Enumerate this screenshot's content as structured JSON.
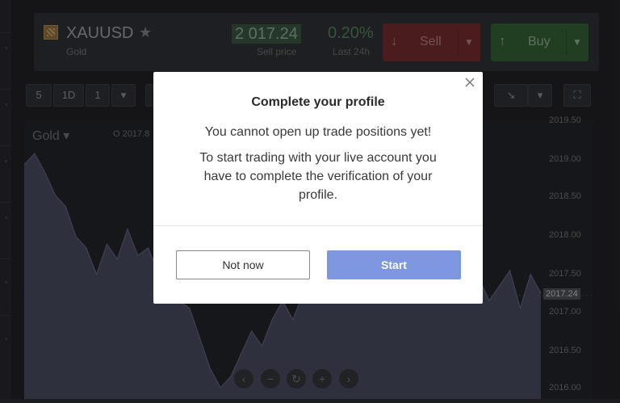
{
  "instrument": {
    "symbol": "XAUUSD",
    "name": "Gold",
    "sell_price": "2 017.24",
    "sell_price_caption": "Sell price",
    "change": "0.20%",
    "change_caption": "Last 24h",
    "sell_label": "Sell",
    "buy_label": "Buy"
  },
  "toolbar": {
    "buttons": [
      "5",
      "1D",
      "1"
    ]
  },
  "chart": {
    "series_label": "Gold ▾",
    "ohlc_text": "O  2017.8",
    "price_axis": [
      "2019.50",
      "2019.00",
      "2018.50",
      "2018.00",
      "2017.50",
      "2017.00",
      "2016.50",
      "2016.00"
    ],
    "last_price_tag": "2017.24"
  },
  "chart_data": {
    "type": "area",
    "ylim": [
      2015.9,
      2019.6
    ],
    "x": [
      0,
      2,
      4,
      6,
      8,
      10,
      12,
      14,
      16,
      18,
      20,
      22,
      24,
      26,
      28,
      30,
      32,
      34,
      36,
      38,
      40,
      42,
      44,
      46,
      48,
      50,
      52,
      54,
      56,
      58,
      60,
      62,
      64,
      66,
      68,
      70,
      72,
      74,
      76,
      78,
      80,
      82,
      84,
      86,
      88,
      90,
      92,
      94,
      96,
      98,
      100
    ],
    "y": [
      2019.0,
      2019.15,
      2018.9,
      2018.6,
      2018.45,
      2018.05,
      2017.9,
      2017.55,
      2017.95,
      2017.75,
      2018.15,
      2017.8,
      2017.9,
      2017.55,
      2017.3,
      2017.2,
      2017.1,
      2016.7,
      2016.3,
      2016.05,
      2016.2,
      2016.5,
      2016.8,
      2016.6,
      2016.95,
      2017.2,
      2016.95,
      2017.3,
      2017.2,
      2017.5,
      2017.6,
      2017.35,
      2017.4,
      2017.2,
      2017.5,
      2017.7,
      2017.45,
      2017.35,
      2017.6,
      2017.5,
      2017.4,
      2017.55,
      2017.3,
      2017.45,
      2017.5,
      2017.2,
      2017.4,
      2017.6,
      2017.1,
      2017.55,
      2017.3
    ]
  },
  "nav_icons": [
    "chevron-left-icon",
    "zoom-out-icon",
    "reset-icon",
    "zoom-in-icon",
    "chevron-right-icon"
  ],
  "modal": {
    "title": "Complete your profile",
    "message": "You cannot open up trade positions yet!",
    "detail": "To start trading with your live account you have to complete the verification of your profile.",
    "secondary_button": "Not now",
    "primary_button": "Start",
    "primary_color": "#7e97de"
  }
}
